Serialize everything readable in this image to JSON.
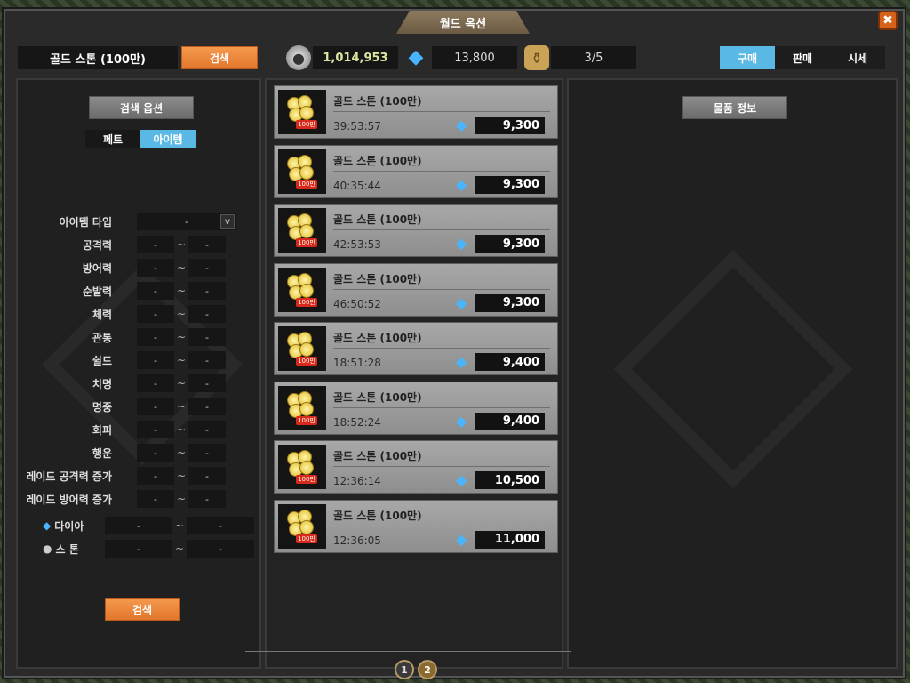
{
  "window": {
    "title": "월드 옥션",
    "close_icon": "close-icon"
  },
  "topbar": {
    "search_text": "골드 스톤 (100만)",
    "search_button": "검색",
    "gold": "1,014,953",
    "gems": "13,800",
    "slots": "3/5",
    "tabs": [
      {
        "label": "구매",
        "active": true
      },
      {
        "label": "판매",
        "active": false
      },
      {
        "label": "시세",
        "active": false
      }
    ]
  },
  "left": {
    "options_title": "검색 옵션",
    "toggle": [
      {
        "label": "페트",
        "active": false
      },
      {
        "label": "아이템",
        "active": true
      }
    ],
    "item_type_label": "아이템 타입",
    "item_type_value": "-",
    "select_arrow": "v",
    "filters": [
      {
        "label": "공격력",
        "min": "-",
        "max": "-"
      },
      {
        "label": "방어력",
        "min": "-",
        "max": "-"
      },
      {
        "label": "순발력",
        "min": "-",
        "max": "-"
      },
      {
        "label": "체력",
        "min": "-",
        "max": "-"
      },
      {
        "label": "관통",
        "min": "-",
        "max": "-"
      },
      {
        "label": "쉴드",
        "min": "-",
        "max": "-"
      },
      {
        "label": "치명",
        "min": "-",
        "max": "-"
      },
      {
        "label": "명중",
        "min": "-",
        "max": "-"
      },
      {
        "label": "회피",
        "min": "-",
        "max": "-"
      },
      {
        "label": "행운",
        "min": "-",
        "max": "-"
      },
      {
        "label": "레이드 공격력 증가",
        "min": "-",
        "max": "-"
      },
      {
        "label": "레이드 방어력 증가",
        "min": "-",
        "max": "-"
      }
    ],
    "tilde": "~",
    "diamond": {
      "label": "다이아",
      "min": "-",
      "max": "-"
    },
    "stone": {
      "label": "스 톤",
      "min": "-",
      "max": "-"
    },
    "search_button": "검색"
  },
  "listings": [
    {
      "name": "골드 스톤 (100만)",
      "time": "39:53:57",
      "price": "9,300"
    },
    {
      "name": "골드 스톤 (100만)",
      "time": "40:35:44",
      "price": "9,300"
    },
    {
      "name": "골드 스톤 (100만)",
      "time": "42:53:53",
      "price": "9,300"
    },
    {
      "name": "골드 스톤 (100만)",
      "time": "46:50:52",
      "price": "9,300"
    },
    {
      "name": "골드 스톤 (100만)",
      "time": "18:51:28",
      "price": "9,400"
    },
    {
      "name": "골드 스톤 (100만)",
      "time": "18:52:24",
      "price": "9,400"
    },
    {
      "name": "골드 스톤 (100만)",
      "time": "12:36:14",
      "price": "10,500"
    },
    {
      "name": "골드 스톤 (100만)",
      "time": "12:36:05",
      "price": "11,000"
    }
  ],
  "coin_tag": "100만",
  "right": {
    "info_title": "물품 정보"
  },
  "pager": {
    "pages": [
      "1",
      "2"
    ],
    "current": "2"
  },
  "colors": {
    "accent_blue": "#5ab8e4",
    "button_orange": "#e2762c",
    "gem_blue": "#49b5ff"
  },
  "icons": {
    "gem": "diamond-icon",
    "stone": "stone-icon",
    "jar": "jar-icon"
  }
}
